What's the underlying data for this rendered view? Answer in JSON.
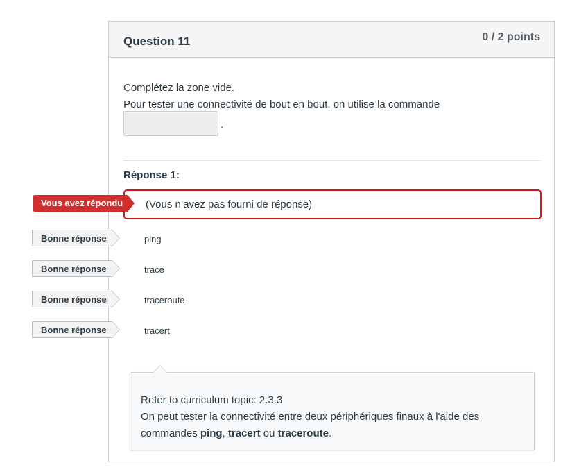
{
  "question": {
    "title": "Question 11",
    "points": "0 / 2 points",
    "instruction_line1": "Complétez la zone vide.",
    "instruction_line2": "Pour tester une connectivité de bout en bout, on utilise la commande",
    "blank_value": "",
    "blank_suffix": "."
  },
  "answers": {
    "heading": "Réponse 1:",
    "your_answer_flag": "Vous avez répondu",
    "your_answer": "(Vous n’avez pas fourni de réponse)",
    "correct_flag": "Bonne réponse",
    "correct": [
      "ping",
      "trace",
      "traceroute",
      "tracert"
    ]
  },
  "feedback": {
    "line1": "Refer to curriculum topic: 2.3.3",
    "line2": "On peut tester la connectivité entre deux périphériques finaux à l'aide des",
    "line3_prefix": "commandes ",
    "cmd1": "ping",
    "sep1": ", ",
    "cmd2": "tracert",
    "sep2": " ou ",
    "cmd3": "traceroute",
    "end": "."
  },
  "colors": {
    "wrong": "#d12f2e",
    "text": "#2d3b45",
    "border": "#c7cdd1"
  }
}
